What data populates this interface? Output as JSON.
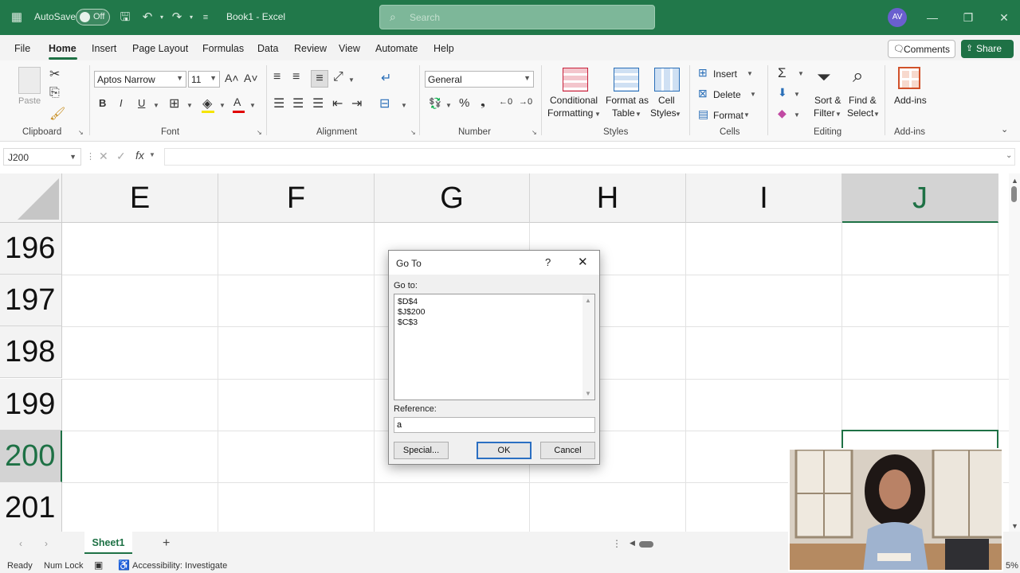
{
  "titlebar": {
    "autosave_label": "AutoSave",
    "autosave_state": "Off",
    "doc_title": "Book1 - Excel",
    "search_placeholder": "Search",
    "avatar_initials": "AV",
    "accent_color": "#21784a"
  },
  "tabs": [
    "File",
    "Home",
    "Insert",
    "Page Layout",
    "Formulas",
    "Data",
    "Review",
    "View",
    "Automate",
    "Help"
  ],
  "active_tab": "Home",
  "comments_label": "Comments",
  "share_label": "Share",
  "ribbon": {
    "clipboard": {
      "label": "Clipboard",
      "paste": "Paste"
    },
    "font": {
      "label": "Font",
      "family": "Aptos Narrow",
      "size": "11"
    },
    "alignment": {
      "label": "Alignment"
    },
    "number": {
      "label": "Number",
      "format": "General"
    },
    "styles": {
      "label": "Styles",
      "cond_fmt_1": "Conditional",
      "cond_fmt_2": "Formatting",
      "fmt_table_1": "Format as",
      "fmt_table_2": "Table",
      "cell_styles_1": "Cell",
      "cell_styles_2": "Styles"
    },
    "cells": {
      "label": "Cells",
      "insert": "Insert",
      "delete": "Delete",
      "format": "Format"
    },
    "editing": {
      "label": "Editing",
      "sort_1": "Sort &",
      "sort_2": "Filter",
      "find_1": "Find &",
      "find_2": "Select"
    },
    "addins": {
      "label": "Add-ins",
      "button": "Add-ins"
    }
  },
  "formula_bar": {
    "name_box": "J200",
    "fx": "fx",
    "value": ""
  },
  "grid": {
    "columns": [
      "E",
      "F",
      "G",
      "H",
      "I",
      "J"
    ],
    "rows": [
      "196",
      "197",
      "198",
      "199",
      "200",
      "201"
    ],
    "selected_column": "J",
    "selected_row": "200"
  },
  "sheet_tabs": [
    "Sheet1"
  ],
  "add_sheet": "+",
  "statusbar": {
    "ready": "Ready",
    "numlock": "Num Lock",
    "accessibility": "Accessibility: Investigate",
    "zoom": "5%"
  },
  "dialog": {
    "title": "Go To",
    "help": "?",
    "close": "✕",
    "goto_label": "Go to:",
    "list_items": [
      "$D$4",
      "$J$200",
      "$C$3"
    ],
    "reference_label": "Reference:",
    "reference_value": "a",
    "special_button": "Special...",
    "ok_button": "OK",
    "cancel_button": "Cancel"
  }
}
